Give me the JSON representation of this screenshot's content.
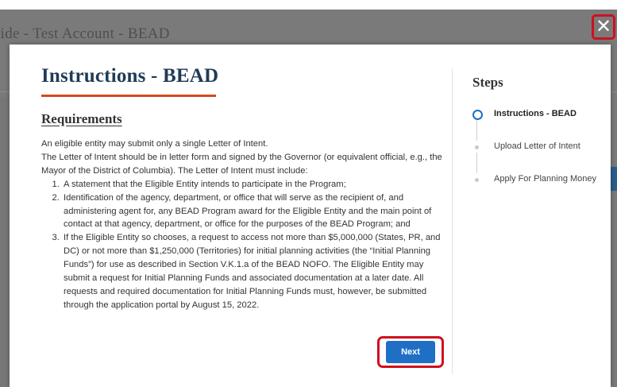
{
  "background": {
    "title": "ride - Test Account - BEAD"
  },
  "close_label": "✕",
  "modal": {
    "title": "Instructions - BEAD",
    "section_heading": "Requirements",
    "intro_lines": [
      "An eligible entity may submit only a single Letter of Intent.",
      "The Letter of Intent should be in letter form and signed by the Governor (or equivalent official, e.g., the Mayor of the District of Columbia).  The Letter of Intent must include:"
    ],
    "requirements": [
      "A statement that the Eligible Entity intends to participate in the Program;",
      "Identification of the agency, department, or office that will serve as the recipient of, and administering agent for, any BEAD Program award for the Eligible Entity and the main point of contact at that agency, department, or office for the purposes of the BEAD Program; and",
      "If the Eligible Entity so chooses, a request to access not more than $5,000,000 (States, PR, and DC) or not more than $1,250,000 (Territories) for initial planning activities (the “Initial Planning Funds”) for use as described in Section V.K.1.a of the BEAD NOFO.  The Eligible Entity may submit a request for Initial Planning Funds and associated documentation at a later date.  All requests and required documentation for Initial Planning Funds must, however, be submitted through the application portal by August 15, 2022."
    ],
    "next_label": "Next"
  },
  "steps": {
    "title": "Steps",
    "items": [
      {
        "label": "Instructions - BEAD",
        "active": true
      },
      {
        "label": "Upload Letter of Intent",
        "active": false
      },
      {
        "label": "Apply For Planning Money",
        "active": false
      }
    ]
  },
  "colors": {
    "accent_blue": "#1f6fc5",
    "title_rule": "#d44a1c",
    "highlight_red": "#d0101e"
  }
}
